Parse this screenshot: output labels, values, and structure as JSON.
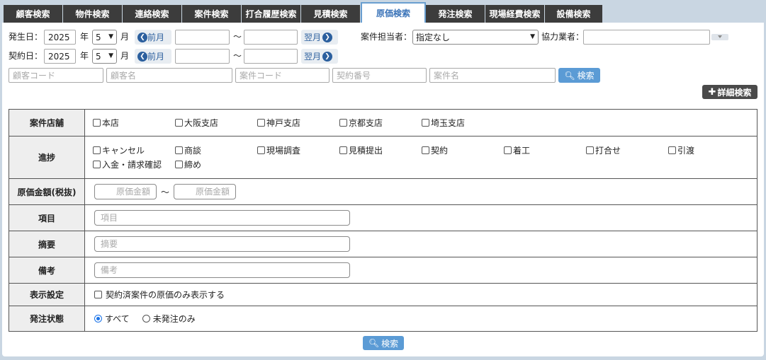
{
  "tabs": [
    {
      "label": "顧客検索",
      "active": false
    },
    {
      "label": "物件検索",
      "active": false
    },
    {
      "label": "連絡検索",
      "active": false
    },
    {
      "label": "案件検索",
      "active": false
    },
    {
      "label": "打合履歴検索",
      "active": false
    },
    {
      "label": "見積検索",
      "active": false
    },
    {
      "label": "原価検索",
      "active": true
    },
    {
      "label": "発注検索",
      "active": false
    },
    {
      "label": "現場経費検索",
      "active": false
    },
    {
      "label": "設備検索",
      "active": false
    }
  ],
  "row1": {
    "label": "発生日：",
    "year": "2025",
    "year_unit": "年",
    "month": "5",
    "month_unit": "月",
    "prev": "前月",
    "tilde": "～",
    "next": "翌月",
    "staff_label": "案件担当者：",
    "staff_value": "指定なし",
    "partner_label": "協力業者："
  },
  "row2": {
    "label": "契約日：",
    "year": "2025",
    "year_unit": "年",
    "month": "5",
    "month_unit": "月",
    "prev": "前月",
    "tilde": "～",
    "next": "翌月"
  },
  "row3": {
    "customer_code": "顧客コード",
    "customer_name": "顧客名",
    "case_code": "案件コード",
    "contract_no": "契約番号",
    "case_name": "案件名",
    "search": "検索"
  },
  "detail_search": "詳細検索",
  "table": {
    "store": {
      "label": "案件店舗",
      "options": [
        "本店",
        "大阪支店",
        "神戸支店",
        "京都支店",
        "埼玉支店"
      ]
    },
    "progress": {
      "label": "進捗",
      "options": [
        "キャンセル",
        "商談",
        "現場調査",
        "見積提出",
        "契約",
        "着工",
        "打合せ",
        "引渡",
        "入金・請求確認",
        "締め"
      ]
    },
    "cost": {
      "label": "原価金額(税抜)",
      "placeholder": "原価金額",
      "tilde": "～"
    },
    "item": {
      "label": "項目",
      "placeholder": "項目"
    },
    "summary": {
      "label": "摘要",
      "placeholder": "摘要"
    },
    "remarks": {
      "label": "備考",
      "placeholder": "備考"
    },
    "display": {
      "label": "表示設定",
      "option": "契約済案件の原価のみ表示する"
    },
    "order_status": {
      "label": "発注状態",
      "options": [
        "すべて",
        "未発注のみ"
      ],
      "selected": "すべて"
    }
  },
  "bottom_search": "検索",
  "colors": {
    "tab_bg": "#3c3c3c",
    "active_tab_text": "#3a73b8",
    "button_blue": "#5b9bd5",
    "nav_blue": "#2b5f9e"
  }
}
